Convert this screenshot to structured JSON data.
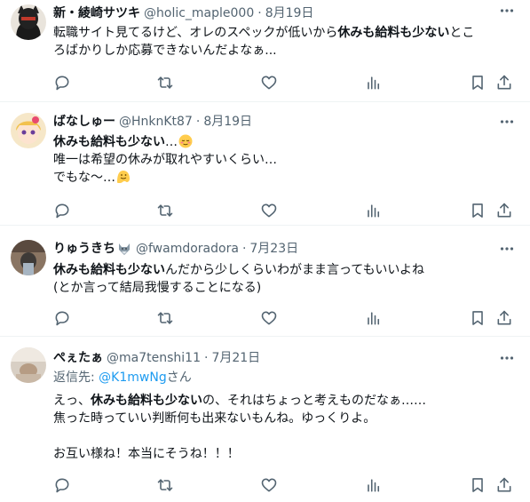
{
  "tweets": [
    {
      "name": "新・綾崎サツキ",
      "handle": "@holic_maple000",
      "date": "8月19日",
      "avatar": "dark-helmet-avatar",
      "line1_pre": "転職サイト見てるけど、オレのスペックが低いから",
      "line1_bold": "休みも給料も少ない",
      "line1_post": "とこ",
      "line2": "ろばかりしか応募できないんだよなぁ..."
    },
    {
      "name": "ばなしゅー",
      "handle": "@HnknKt87",
      "date": "8月19日",
      "avatar": "anime-girl-avatar",
      "line1_bold": "休みも給料も少ない",
      "line1_post": "…",
      "line1_emoji": "relieved-face-emoji",
      "line2": "唯一は希望の休みが取れやすいくらい…",
      "line3": "でもな〜…",
      "line3_emoji": "melting-face-emoji"
    },
    {
      "name": "りゅうきち",
      "name_emoji": "wolf-emoji",
      "handle": "@fwamdoradora",
      "date": "7月23日",
      "avatar": "photo-avatar",
      "line1_bold": "休みも給料も少ない",
      "line1_post": "んだから少しくらいわがまま言ってもいいよね",
      "line2": "(とか言って結局我慢することになる)"
    },
    {
      "name": "ぺぇたぁ",
      "handle": "@ma7tenshi11",
      "date": "7月21日",
      "avatar": "photo-avatar",
      "reply_prefix": "返信先: ",
      "reply_mention": "@K1mwNg",
      "reply_suffix": "さん",
      "line1_pre": "えっ、",
      "line1_bold": "休みも給料も少ない",
      "line1_post": "の、それはちょっと考えものだなぁ……",
      "line2": "焦った時っていい判断何も出来ないもんね。ゆっくりよ。",
      "line3": "お互い様ね！本当にそうね！！！"
    }
  ],
  "action_icons": [
    "reply-icon",
    "retweet-icon",
    "like-icon",
    "views-icon",
    "bookmark-icon",
    "share-icon"
  ],
  "colors": {
    "text": "#0f1419",
    "secondary": "#536471",
    "link": "#1d9bf0",
    "divider": "#eff3f4"
  }
}
